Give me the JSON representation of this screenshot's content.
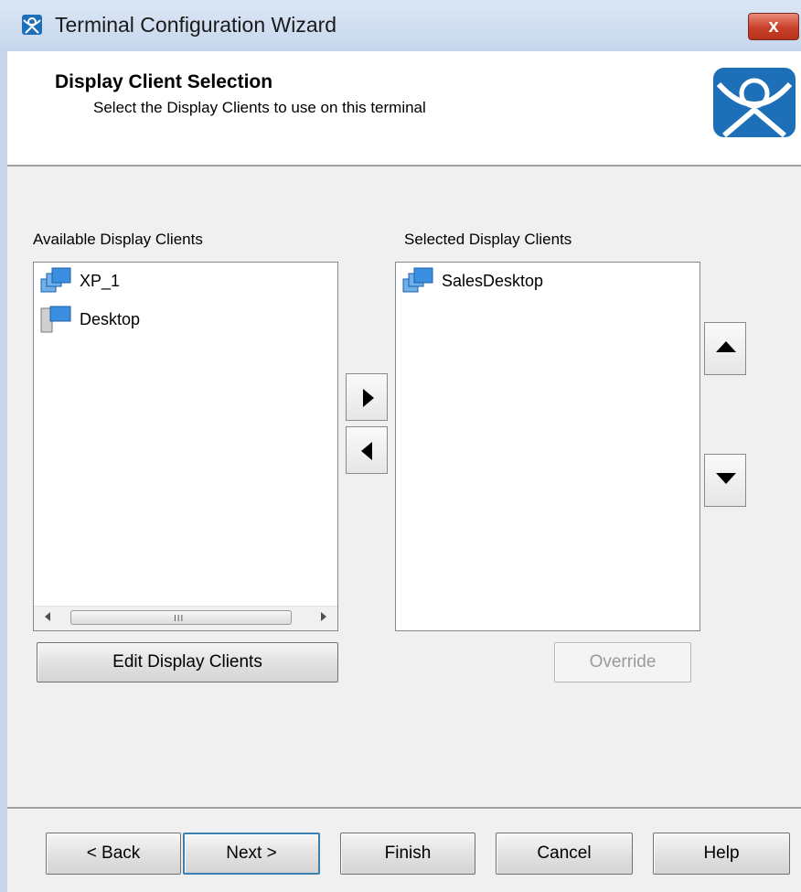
{
  "window": {
    "title": "Terminal Configuration Wizard",
    "close_label": "x"
  },
  "header": {
    "title": "Display Client Selection",
    "subtitle": "Select the Display Clients to use on this terminal"
  },
  "available": {
    "label": "Available Display Clients",
    "items": [
      {
        "label": "XP_1",
        "icon": "display-client-group-icon"
      },
      {
        "label": "Desktop",
        "icon": "desktop-client-icon"
      }
    ],
    "scroll_grip": "III"
  },
  "selected": {
    "label": "Selected Display Clients",
    "items": [
      {
        "label": "SalesDesktop",
        "icon": "display-client-group-icon"
      }
    ]
  },
  "buttons": {
    "edit_display_clients": "Edit Display Clients",
    "override": "Override",
    "back": "< Back",
    "next": "Next >",
    "finish": "Finish",
    "cancel": "Cancel",
    "help": "Help"
  },
  "colors": {
    "accent": "#1d6fb8",
    "titlebar": "#c6d6ec",
    "close": "#c7402a"
  }
}
